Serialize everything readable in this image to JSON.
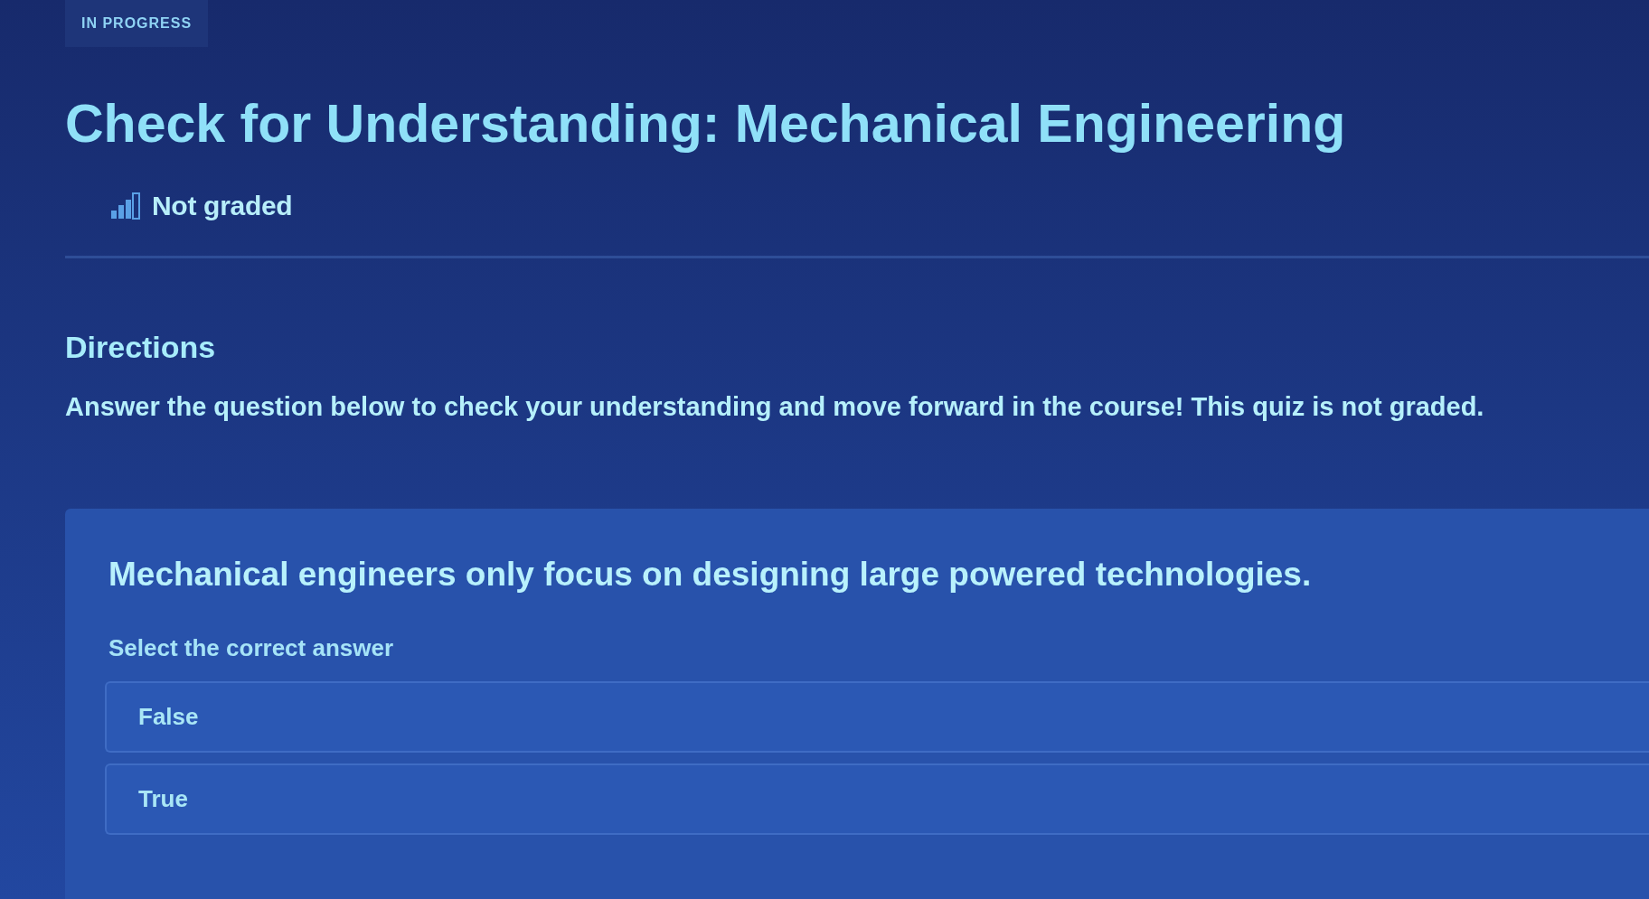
{
  "status_badge": "IN PROGRESS",
  "title": "Check for Understanding: Mechanical Engineering",
  "grading": {
    "label": "Not graded"
  },
  "directions": {
    "heading": "Directions",
    "text": "Answer the question below to check your understanding and move forward in the course! This quiz is not graded."
  },
  "question": {
    "prompt": "Mechanical engineers only focus on designing large powered technologies.",
    "instruction": "Select the correct answer",
    "options": [
      {
        "label": "False",
        "selected": false
      },
      {
        "label": "True",
        "selected": false
      }
    ]
  }
}
